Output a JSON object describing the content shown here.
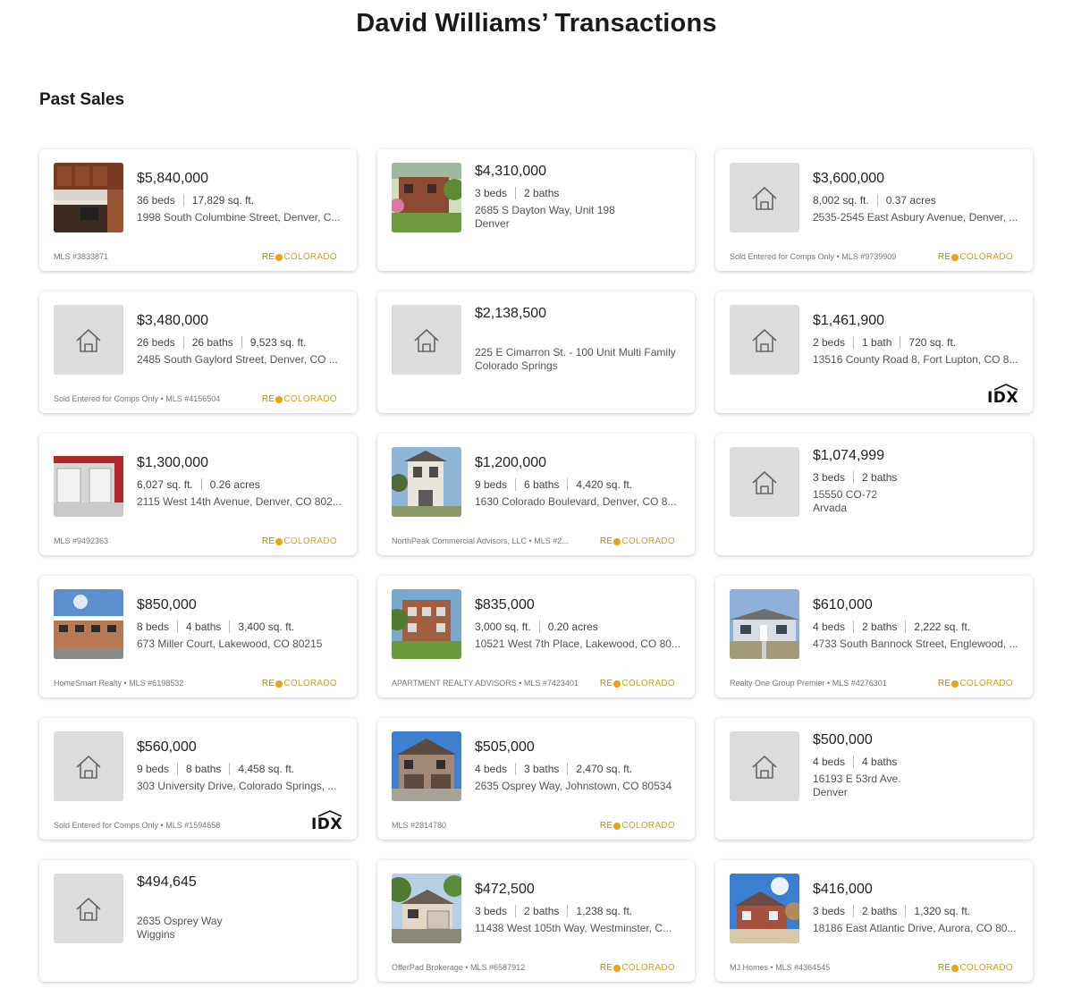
{
  "title": "David Williams’ Transactions",
  "section": "Past Sales",
  "colors": {
    "placeholder_bg": "#dcdcdc",
    "re_colorado_accent": "#e9a21a"
  },
  "logos": {
    "re_colorado": {
      "left": "RE",
      "right": "COLORADO"
    },
    "idx": "IDX"
  },
  "listings": [
    {
      "photo": "kitchen",
      "price": "$5,840,000",
      "stats": [
        "36 beds",
        "17,829 sq. ft."
      ],
      "address": "1998 South Columbine Street, Denver, C...",
      "footer": "MLS #3833871",
      "logo": "re"
    },
    {
      "photo": "brick-house",
      "price": "$4,310,000",
      "stats": [
        "3 beds",
        "2 baths"
      ],
      "address": "2685 S Dayton Way, Unit 198",
      "city": "Denver",
      "footer": "",
      "logo": ""
    },
    {
      "photo": "placeholder",
      "price": "$3,600,000",
      "stats": [
        "8,002 sq. ft.",
        "0.37 acres"
      ],
      "address": "2535-2545 East Asbury Avenue, Denver, ...",
      "footer": "Sold Entered for Comps Only • MLS #9739909",
      "logo": "re"
    },
    {
      "photo": "placeholder",
      "price": "$3,480,000",
      "stats": [
        "26 beds",
        "26 baths",
        "9,523 sq. ft."
      ],
      "address": "2485 South Gaylord Street, Denver, CO ...",
      "footer": "Sold Entered for Comps Only • MLS #4156504",
      "logo": "re"
    },
    {
      "photo": "placeholder",
      "price": "$2,138,500",
      "stats": [],
      "address": "225 E Cimarron St. - 100 Unit Multi Family",
      "city": "Colorado Springs",
      "footer": "",
      "logo": ""
    },
    {
      "photo": "placeholder",
      "price": "$1,461,900",
      "stats": [
        "2 beds",
        "1 bath",
        "720 sq. ft."
      ],
      "address": "13516 County Road 8, Fort Lupton, CO 8...",
      "footer": "",
      "logo": "idx"
    },
    {
      "photo": "garage",
      "price": "$1,300,000",
      "stats": [
        "6,027 sq. ft.",
        "0.26 acres"
      ],
      "address": "2115 West 14th Avenue, Denver, CO 802...",
      "footer": "MLS #9492363",
      "logo": "re"
    },
    {
      "photo": "white-house",
      "price": "$1,200,000",
      "stats": [
        "9 beds",
        "6 baths",
        "4,420 sq. ft."
      ],
      "address": "1630 Colorado Boulevard, Denver, CO 8...",
      "footer": "NorthPeak Commercial Advisors, LLC • MLS #2...",
      "logo": "re"
    },
    {
      "photo": "placeholder",
      "price": "$1,074,999",
      "stats": [
        "3 beds",
        "2 baths"
      ],
      "address": "15550 CO-72",
      "city": "Arvada",
      "footer": "",
      "logo": ""
    },
    {
      "photo": "apartments",
      "price": "$850,000",
      "stats": [
        "8 beds",
        "4 baths",
        "3,400 sq. ft."
      ],
      "address": "673 Miller Court, Lakewood, CO 80215",
      "footer": "HomeSmart Realty • MLS #6198532",
      "logo": "re"
    },
    {
      "photo": "brick-apartments",
      "price": "$835,000",
      "stats": [
        "3,000 sq. ft.",
        "0.20 acres"
      ],
      "address": "10521 West 7th Place, Lakewood, CO 80...",
      "footer": "APARTMENT REALTY ADVISORS • MLS #7423401",
      "logo": "re"
    },
    {
      "photo": "ranch-house",
      "price": "$610,000",
      "stats": [
        "4 beds",
        "2 baths",
        "2,222 sq. ft."
      ],
      "address": "4733 South Bannock Street, Englewood, ...",
      "footer": "Realty One Group Premier • MLS #4276301",
      "logo": "re"
    },
    {
      "photo": "placeholder",
      "price": "$560,000",
      "stats": [
        "9 beds",
        "8 baths",
        "4,458 sq. ft."
      ],
      "address": "303 University Drive, Colorado Springs, ...",
      "footer": "Sold Entered for Comps Only • MLS #1594658",
      "logo": "idx"
    },
    {
      "photo": "townhouse",
      "price": "$505,000",
      "stats": [
        "4 beds",
        "3 baths",
        "2,470 sq. ft."
      ],
      "address": "2635 Osprey Way, Johnstown, CO 80534",
      "footer": "MLS #2814780",
      "logo": "re"
    },
    {
      "photo": "placeholder",
      "price": "$500,000",
      "stats": [
        "4 beds",
        "4 baths"
      ],
      "address": "16193 E 53rd Ave.",
      "city": "Denver",
      "footer": "",
      "logo": ""
    },
    {
      "photo": "placeholder",
      "price": "$494,645",
      "stats": [],
      "address": "2635 Osprey Way",
      "city": "Wiggins",
      "footer": "",
      "logo": ""
    },
    {
      "photo": "split-level",
      "price": "$472,500",
      "stats": [
        "3 beds",
        "2 baths",
        "1,238 sq. ft."
      ],
      "address": "11438 West 105th Way, Westminster, C...",
      "footer": "OfferPad Brokerage • MLS #6587912",
      "logo": "re"
    },
    {
      "photo": "red-house",
      "price": "$416,000",
      "stats": [
        "3 beds",
        "2 baths",
        "1,320 sq. ft."
      ],
      "address": "18186 East Atlantic Drive, Aurora, CO 80...",
      "footer": "MJ Homes • MLS #4364545",
      "logo": "re"
    }
  ]
}
